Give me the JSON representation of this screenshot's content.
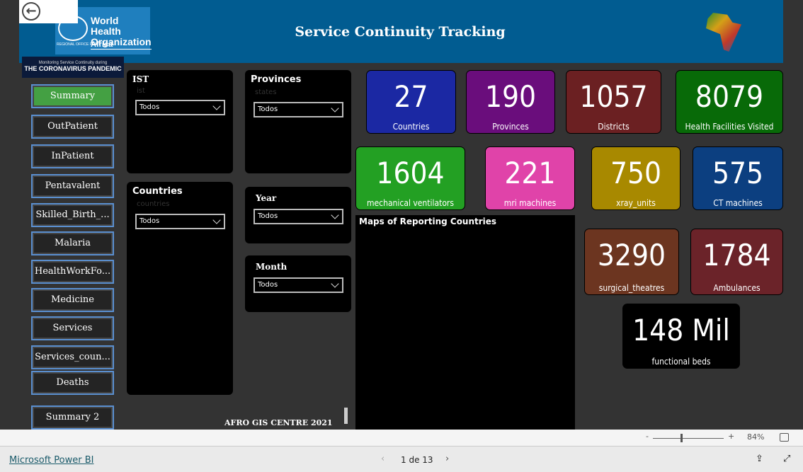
{
  "header": {
    "title": "Service Continuity Tracking",
    "logo": {
      "line1": "World Health",
      "line2": "Organization",
      "regional": "REGIONAL OFFICE FOR",
      "region": "Africa"
    },
    "banner": {
      "line1": "Monitoring Service Continuity during",
      "line2": "THE CORONAVIRUS PANDEMIC"
    }
  },
  "nav": [
    {
      "label": "Summary",
      "active": true
    },
    {
      "label": "OutPatient"
    },
    {
      "label": "InPatient"
    },
    {
      "label": "Pentavalent"
    },
    {
      "label": "Skilled_Birth_..."
    },
    {
      "label": "Malaria"
    },
    {
      "label": "HealthWorkFo..."
    },
    {
      "label": "Medicine"
    },
    {
      "label": "Services"
    },
    {
      "label": "Services_coun..."
    },
    {
      "label": "Deaths"
    },
    {
      "label": "Summary 2"
    }
  ],
  "slicers": {
    "ist": {
      "title": "IST",
      "field": "ist",
      "value": "Todos"
    },
    "countries": {
      "title": "Countries",
      "field": "countries",
      "value": "Todos"
    },
    "provinces": {
      "title": "Provinces",
      "field": "states",
      "value": "Todos"
    },
    "year": {
      "title": "Year",
      "value": "Todos"
    },
    "month": {
      "title": "Month",
      "value": "Todos"
    }
  },
  "kpis": [
    {
      "value": "27",
      "label": "Countries",
      "color": "#1b28a3"
    },
    {
      "value": "190",
      "label": "Provinces",
      "color": "#6a0d7c"
    },
    {
      "value": "1057",
      "label": "Districts",
      "color": "#6b2022"
    },
    {
      "value": "8079",
      "label": "Health Facilities Visited",
      "color": "#086a08"
    },
    {
      "value": "1604",
      "label": "mechanical ventilators",
      "color": "#23a023"
    },
    {
      "value": "221",
      "label": "mri machines",
      "color": "#e043a9"
    },
    {
      "value": "750",
      "label": "xray_units",
      "color": "#a88900"
    },
    {
      "value": "575",
      "label": "CT machines",
      "color": "#0c3f80"
    },
    {
      "value": "3290",
      "label": "surgical_theatres",
      "color": "#6c3520"
    },
    {
      "value": "1784",
      "label": "Ambulances",
      "color": "#6b2329"
    },
    {
      "value": "148 Mil",
      "label": "functional beds",
      "color": "#000000"
    }
  ],
  "map": {
    "title": "Maps of Reporting Countries"
  },
  "credit": "AFRO GIS CENTRE 2021",
  "zoom": {
    "minus": "-",
    "plus": "+",
    "level": "84%",
    "value_percent": 84
  },
  "footer": {
    "brand": "Microsoft Power BI",
    "page": "1 de 13"
  }
}
